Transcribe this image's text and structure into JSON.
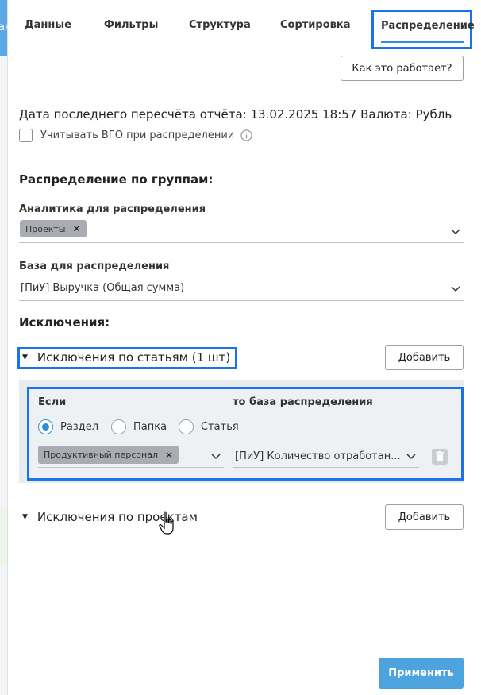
{
  "tabs": [
    {
      "label": "Данные"
    },
    {
      "label": "Фильтры"
    },
    {
      "label": "Структура"
    },
    {
      "label": "Сортировка"
    },
    {
      "label": "Распределение",
      "active": true
    }
  ],
  "left_strip_text": "ан",
  "how_it_works_button": "Как это работает?",
  "recalc_info": "Дата последнего пересчёта отчёта: 13.02.2025 18:57 Валюта: Рубль",
  "vgo_checkbox": {
    "label": "Учитывать ВГО при распределении",
    "checked": false
  },
  "distribution_groups_title": "Распределение по группам:",
  "analytics": {
    "label": "Аналитика для распределения",
    "chips": [
      "Проекты"
    ]
  },
  "base": {
    "label": "База для распределения",
    "value": "[ПиУ] Выручка (Общая сумма)"
  },
  "exclusions_title": "Исключения:",
  "exclusions_by_articles": {
    "title": "Исключения по статьям (1 шт)",
    "add_button": "Добавить",
    "rule": {
      "if_label": "Если",
      "then_label": "то база распределения",
      "radios": [
        {
          "label": "Раздел",
          "selected": true
        },
        {
          "label": "Папка",
          "selected": false
        },
        {
          "label": "Статья",
          "selected": false
        }
      ],
      "chip": "Продуктивный персонал",
      "base_value": "[ПиУ] Количество отработан..."
    }
  },
  "exclusions_by_projects": {
    "title": "Исключения по проектам",
    "add_button": "Добавить"
  },
  "apply_button": "Применить",
  "colors": {
    "accent": "#1a73e8",
    "primary_button": "#4ca3dd",
    "chip": "#a9adb3"
  }
}
